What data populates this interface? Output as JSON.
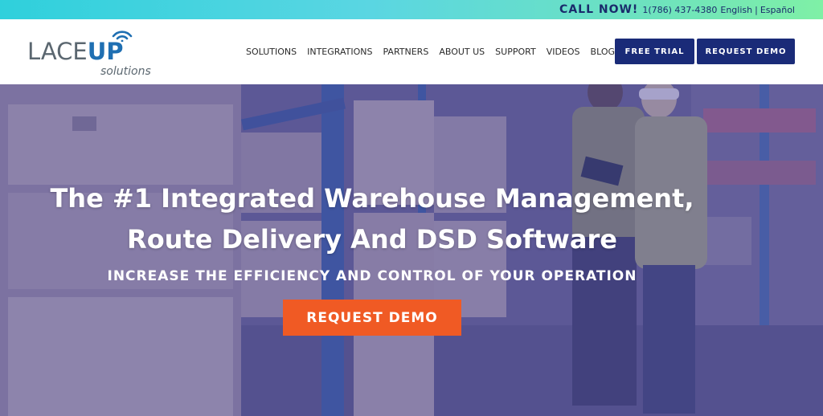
{
  "topbar": {
    "call_label": "CALL NOW!",
    "phone": "1(786) 437-4380",
    "lang_english": "English",
    "separator": "|",
    "lang_spanish": "Español"
  },
  "logo": {
    "lace": "LACE",
    "up": "UP",
    "sub": "solutions"
  },
  "nav": {
    "items": [
      "SOLUTIONS",
      "INTEGRATIONS",
      "PARTNERS",
      "ABOUT US",
      "SUPPORT",
      "VIDEOS",
      "BLOG"
    ],
    "free_trial": "FREE TRIAL",
    "request_demo": "REQUEST DEMO"
  },
  "hero": {
    "title_line1": "The #1 Integrated Warehouse Management,",
    "title_line2": "Route Delivery And DSD Software",
    "subtitle": "INCREASE THE EFFICIENCY AND CONTROL OF YOUR OPERATION",
    "cta": "REQUEST DEMO"
  },
  "colors": {
    "topbar_gradient_start": "#2fd0dc",
    "topbar_gradient_end": "#7ff0a6",
    "brand_navy": "#1a2b78",
    "logo_gray": "#5b6770",
    "logo_blue": "#1f6fb2",
    "cta_orange": "#f05a24",
    "hero_tint": "#53518f"
  }
}
